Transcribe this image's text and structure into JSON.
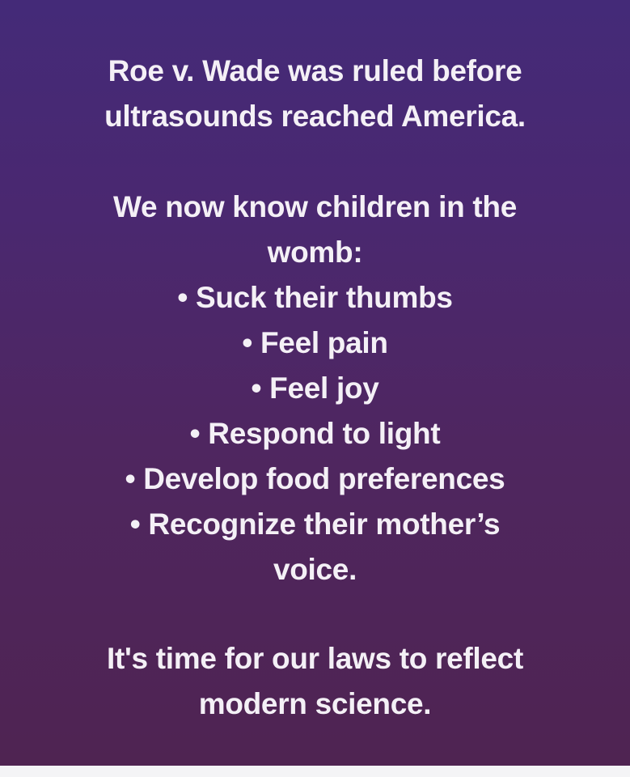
{
  "intro": {
    "lines": [
      "Roe v. Wade was ruled before",
      "ultrasounds reached America."
    ]
  },
  "middle": {
    "lead_lines": [
      "We now know children in the",
      "womb:"
    ],
    "bullet_symbol": "•",
    "bullets": [
      "Suck their thumbs",
      "Feel pain",
      "Feel joy",
      "Respond to light",
      "Develop food preferences",
      "Recognize their mother’s"
    ],
    "continuation": "voice."
  },
  "closing": {
    "lines": [
      "It's time for our laws to reflect",
      "modern science."
    ]
  },
  "colors": {
    "gradient_top": "#442a78",
    "gradient_bottom": "#4f2452",
    "text": "#f4f0f6"
  }
}
